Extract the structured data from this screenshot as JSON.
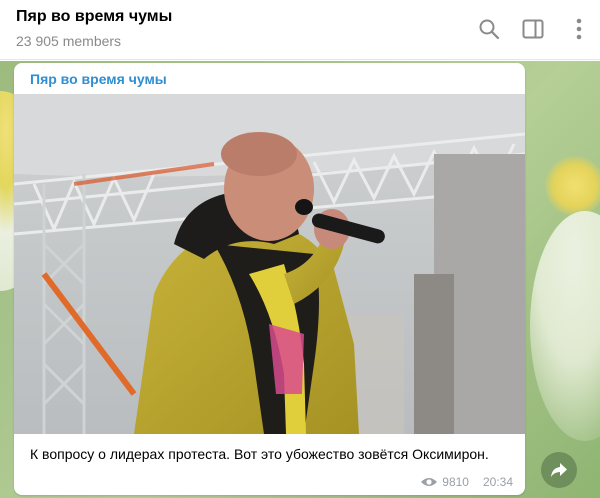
{
  "header": {
    "title": "Пяр во время чумы",
    "subtitle": "23 905 members",
    "icons": [
      "search-icon",
      "sidebar-toggle-icon",
      "more-vertical-icon"
    ]
  },
  "message": {
    "author": "Пяр во время чумы",
    "photo_alt": "person singing into microphone",
    "text": "К вопросу о лидерах протеста. Вот это убожество зовётся Оксимирон.",
    "views": "9810",
    "time": "20:34"
  },
  "actions": {
    "share_icon": "share-arrow-icon"
  },
  "colors": {
    "author": "#2f8fd1",
    "meta": "#9aa0a6",
    "background": "#a7c48c"
  }
}
